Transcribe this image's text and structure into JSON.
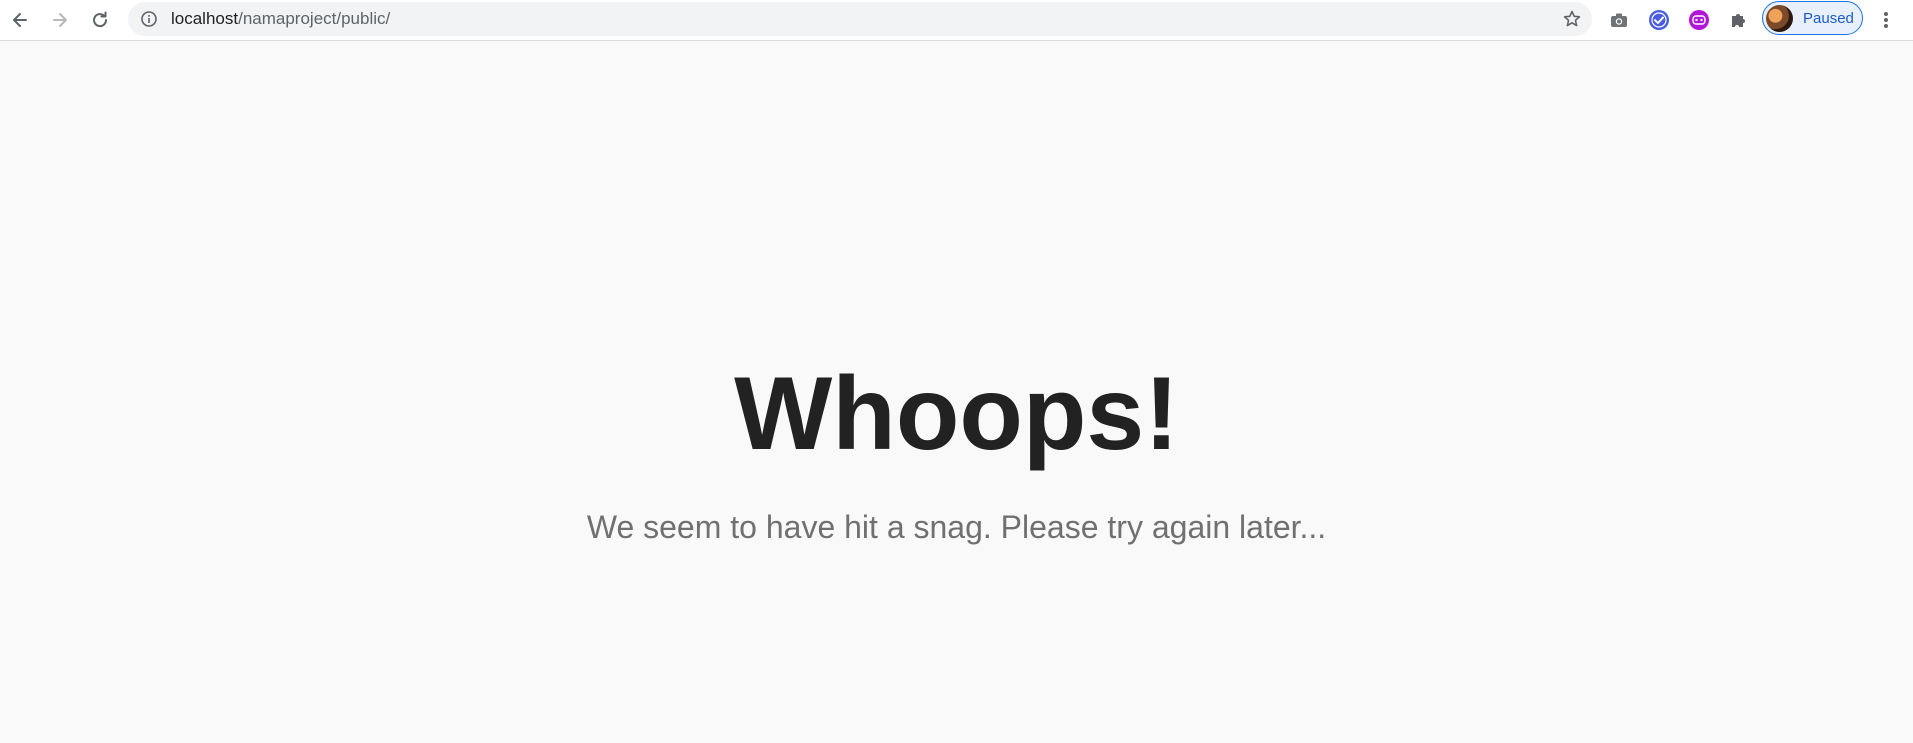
{
  "browser": {
    "url_host": "localhost",
    "url_path": "/namaproject/public/",
    "profile_label": "Paused",
    "icons": {
      "back": "arrow-left-icon",
      "forward": "arrow-right-icon",
      "reload": "reload-icon",
      "site_info": "info-icon",
      "bookmark": "star-icon",
      "screenshot": "camera-icon",
      "extension_1": "check-circle-icon",
      "extension_2": "face-icon",
      "extensions": "puzzle-icon",
      "menu": "more-vertical-icon"
    },
    "colors": {
      "accent": "#1a73e8",
      "ext_1": "#4a5de0",
      "ext_2": "#b115d6"
    }
  },
  "page": {
    "title": "Whoops!",
    "message": "We seem to have hit a snag. Please try again later..."
  }
}
